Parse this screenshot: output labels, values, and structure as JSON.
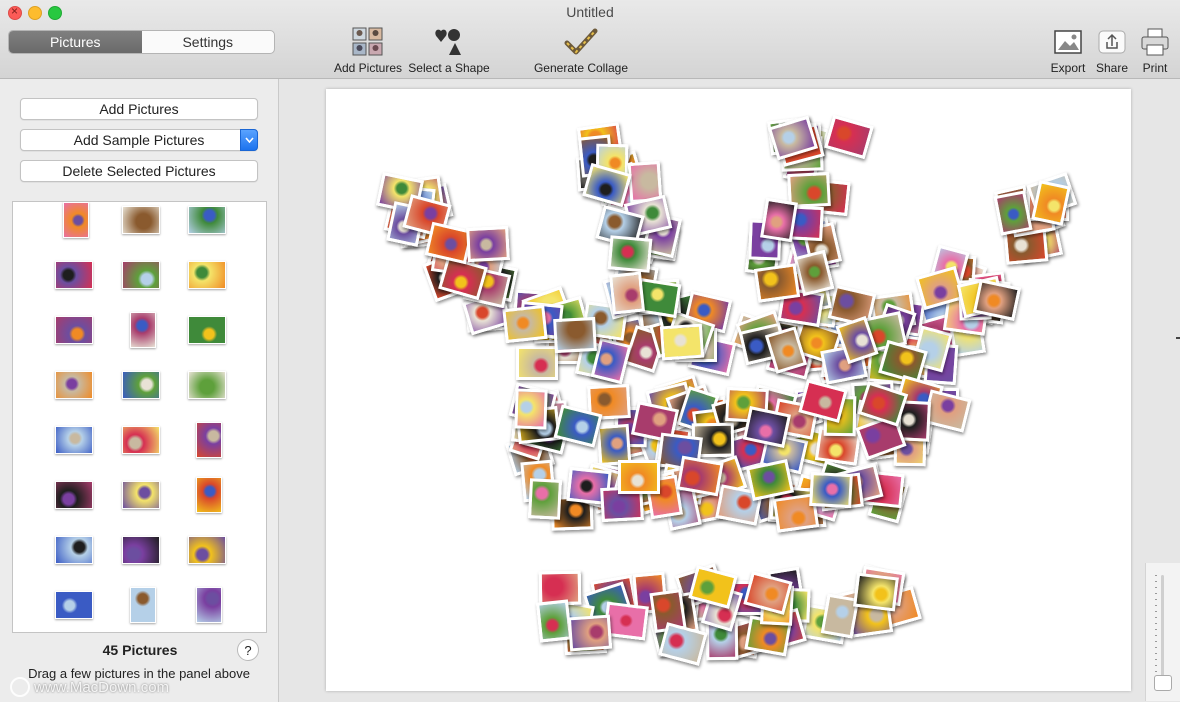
{
  "window": {
    "title": "Untitled"
  },
  "tabs": {
    "pictures": "Pictures",
    "settings": "Settings"
  },
  "toolbar": {
    "add_pictures": "Add Pictures",
    "select_shape": "Select a Shape",
    "generate_collage": "Generate Collage",
    "export": "Export",
    "share": "Share",
    "print": "Print"
  },
  "sidebar": {
    "add_pictures": "Add Pictures",
    "add_sample_pictures": "Add Sample Pictures",
    "delete_selected": "Delete Selected Pictures",
    "count": "45 Pictures",
    "help": "?",
    "hint": "Drag a few pictures in the panel above"
  },
  "watermark": "www.MacDown.com",
  "colors": {
    "accent": "#1c73ee",
    "photo_palette": [
      "#f2c21b",
      "#d9472b",
      "#7a3fa0",
      "#e86fa8",
      "#3a5bc4",
      "#f08a24",
      "#3f8a3a",
      "#c8b9a0",
      "#1e1e1e",
      "#e8e2d5",
      "#a83c6c",
      "#5ea03b",
      "#b5d0e8",
      "#8a5a2e",
      "#d62f52",
      "#f4e46a",
      "#6c4ea0",
      "#e0a080"
    ]
  }
}
